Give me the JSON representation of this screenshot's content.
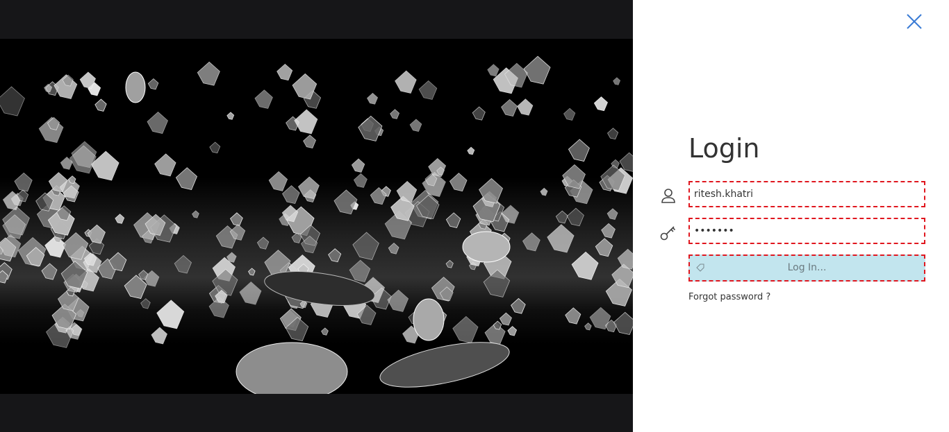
{
  "login": {
    "title": "Login",
    "username_value": "ritesh.khatri",
    "password_value": "*******",
    "submit_label": "Log In...",
    "forgot_password_label": "Forgot password ?",
    "icons": {
      "close": "close-icon",
      "username": "user-icon",
      "password": "key-icon",
      "submit": "tag-icon"
    }
  },
  "colors": {
    "media_background": "#161618",
    "close_icon": "#3a7bd5",
    "field_border": "#e0161e",
    "button_background": "#c2e5ee",
    "title_text": "#333333"
  }
}
